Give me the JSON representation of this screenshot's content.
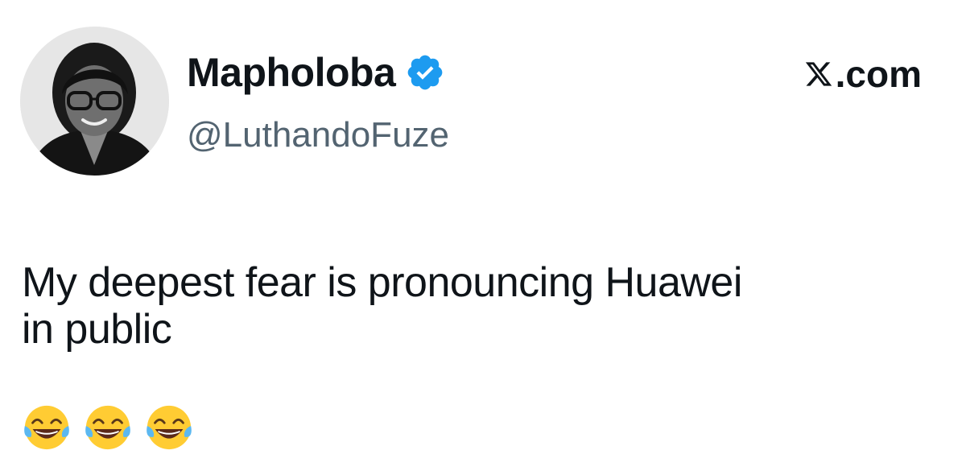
{
  "author": {
    "display_name": "Mapholoba",
    "handle": "@LuthandoFuze",
    "verified_icon": "verified-badge-icon",
    "verified_color": "#1d9bf0"
  },
  "source": {
    "label": ".com",
    "icon": "x-logo-icon"
  },
  "tweet": {
    "text_line_1": "My deepest fear is pronouncing Huawei",
    "text_line_2": "in public",
    "emojis": [
      "face-with-tears-of-joy",
      "face-with-tears-of-joy",
      "face-with-tears-of-joy"
    ]
  },
  "colors": {
    "text": "#0f1419",
    "secondary": "#536471",
    "background": "#ffffff"
  }
}
